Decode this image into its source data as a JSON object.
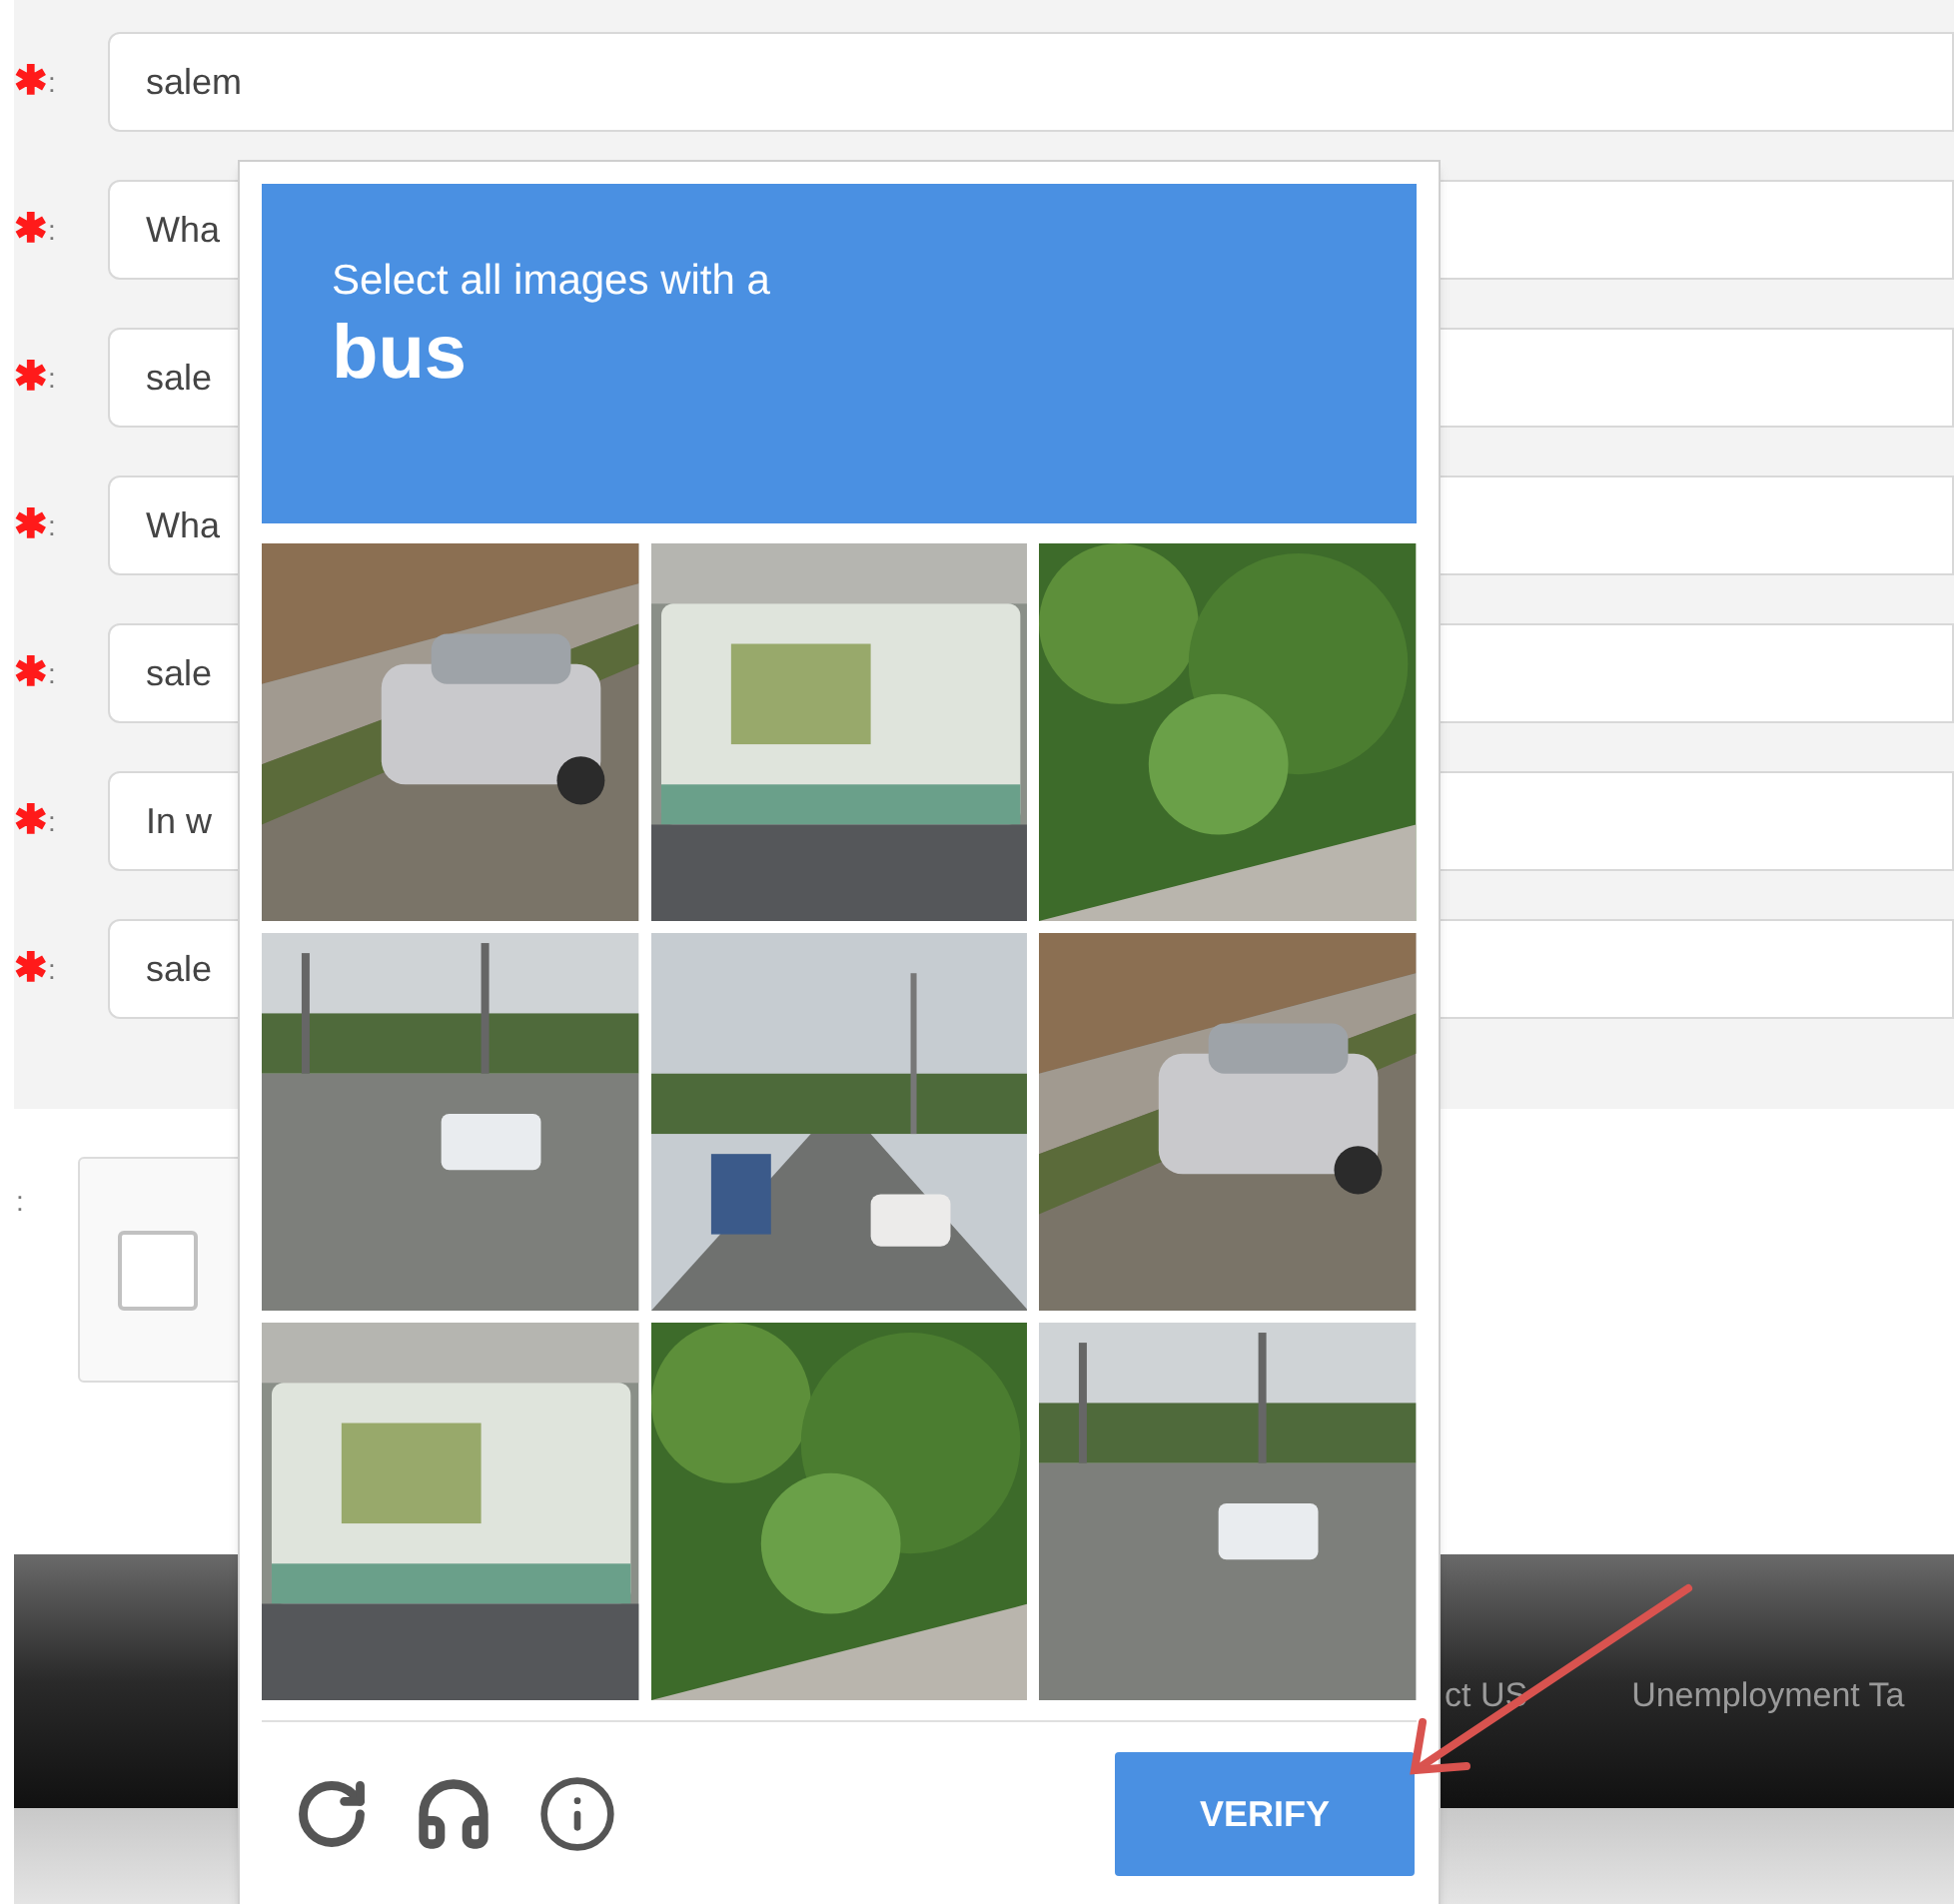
{
  "form_rows": [
    {
      "mark": "✱",
      "colon": ":",
      "value": "salem"
    },
    {
      "mark": "✱",
      "colon": ":",
      "value": "Wha"
    },
    {
      "mark": "✱",
      "colon": ":",
      "value": "sale"
    },
    {
      "mark": "✱",
      "colon": ":",
      "value": "Wha"
    },
    {
      "mark": "✱",
      "colon": ":",
      "value": "sale"
    },
    {
      "mark": "✱",
      "colon": ":",
      "value": "In w"
    },
    {
      "mark": "✱",
      "colon": ":",
      "value": "sale"
    }
  ],
  "captcha_row": {
    "colon": ":",
    "checked": false
  },
  "footer": {
    "links": [
      "ct US",
      "Unemployment Ta"
    ]
  },
  "challenge": {
    "prompt": "Select all images with a",
    "target": "bus",
    "verify": "VERIFY"
  }
}
